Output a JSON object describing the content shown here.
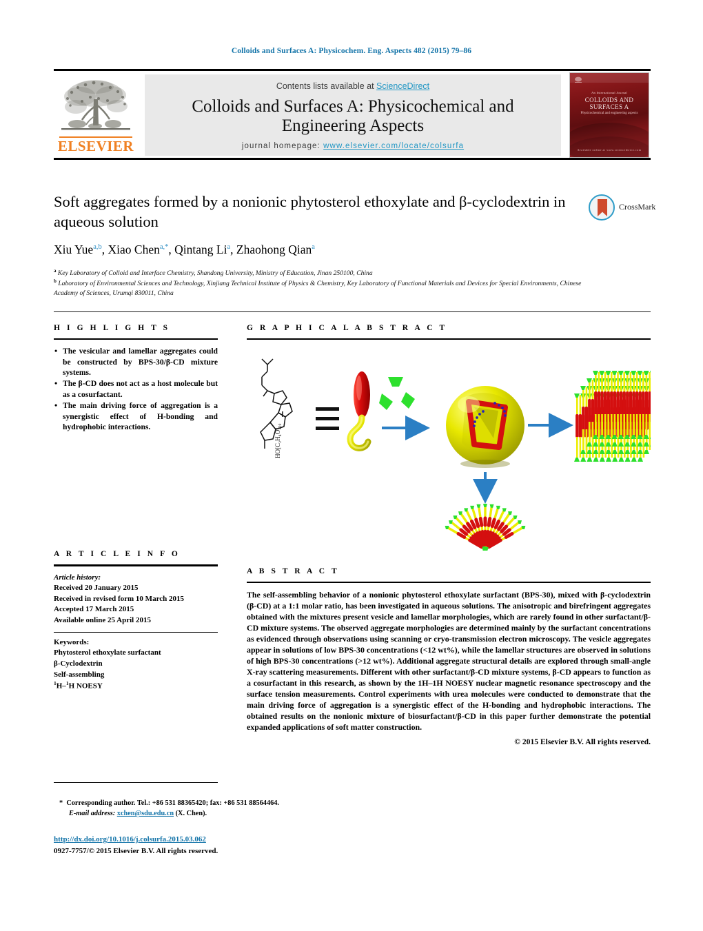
{
  "running_head": "Colloids and Surfaces A: Physicochem. Eng. Aspects 482 (2015) 79–86",
  "masthead": {
    "contents_prefix": "Contents lists available at ",
    "sciencedirect": "ScienceDirect",
    "journal_title_line1": "Colloids and Surfaces A: Physicochemical and",
    "journal_title_line2": "Engineering Aspects",
    "homepage_prefix": "journal homepage:",
    "homepage_url": "www.elsevier.com/locate/colsurfa",
    "publisher": "ELSEVIER",
    "cover": {
      "line_top": "An International Journal",
      "title": "COLLOIDS AND SURFACES A",
      "subtitle": "Physicochemical and engineering aspects",
      "bottom": "Available online at www.sciencedirect.com"
    }
  },
  "article": {
    "title": "Soft aggregates formed by a nonionic phytosterol ethoxylate and β-cyclodextrin in aqueous solution",
    "crossmark_label": "CrossMark",
    "authors": [
      {
        "name": "Xiu Yue",
        "marks": "a,b"
      },
      {
        "name": "Xiao Chen",
        "marks": "a,*"
      },
      {
        "name": "Qintang Li",
        "marks": "a"
      },
      {
        "name": "Zhaohong Qian",
        "marks": "a"
      }
    ],
    "affiliations": [
      {
        "mark": "a",
        "text": "Key Laboratory of Colloid and Interface Chemistry, Shandong University, Ministry of Education, Jinan 250100, China"
      },
      {
        "mark": "b",
        "text": "Laboratory of Environmental Sciences and Technology, Xinjiang Technical Institute of Physics & Chemistry, Key Laboratory of Functional Materials and Devices for Special Environments, Chinese Academy of Sciences, Urumqi 830011, China"
      }
    ]
  },
  "highlights": {
    "heading": "H I G H L I G H T S",
    "items": [
      "The vesicular and lamellar aggregates could be constructed by BPS-30/β-CD mixture systems.",
      "The β-CD does not act as a host molecule but as a cosurfactant.",
      "The main driving force of aggregation is a synergistic effect of H-bonding and hydrophobic interactions."
    ]
  },
  "graphical_abstract": {
    "heading": "G R A P H I C A L   A B S T R A C T",
    "molecule_label": "HO[C2H4O]30",
    "equals_symbol": "=",
    "elements": {
      "surfactant": "BPS-30 surfactant cartoon",
      "cyclodextrin": "β-CD green wedge trimer",
      "vesicle": "cut-away vesicle sphere",
      "lamellar": "lamellar bilayer stack",
      "fan": "curved bilayer fan"
    }
  },
  "article_info": {
    "heading": "A R T I C L E   I N F O",
    "history_label": "Article history:",
    "history": [
      "Received 20 January 2015",
      "Received in revised form 10 March 2015",
      "Accepted 17 March 2015",
      "Available online 25 April 2015"
    ],
    "keywords_label": "Keywords:",
    "keywords": [
      "Phytosterol ethoxylate surfactant",
      "β-Cyclodextrin",
      "Self-assembling",
      "1H–1H NOESY"
    ]
  },
  "abstract": {
    "heading": "A B S T R A C T",
    "text": "The self-assembling behavior of a nonionic phytosterol ethoxylate surfactant (BPS-30), mixed with β-cyclodextrin (β-CD) at a 1:1 molar ratio, has been investigated in aqueous solutions. The anisotropic and birefringent aggregates obtained with the mixtures present vesicle and lamellar morphologies, which are rarely found in other surfactant/β-CD mixture systems. The observed aggregate morphologies are determined mainly by the surfactant concentrations as evidenced through observations using scanning or cryo-transmission electron microscopy. The vesicle aggregates appear in solutions of low BPS-30 concentrations (<12 wt%), while the lamellar structures are observed in solutions of high BPS-30 concentrations (>12 wt%). Additional aggregate structural details are explored through small-angle X-ray scattering measurements. Different with other surfactant/β-CD mixture systems, β-CD appears to function as a cosurfactant in this research, as shown by the 1H–1H NOESY nuclear magnetic resonance spectroscopy and the surface tension measurements. Control experiments with urea molecules were conducted to demonstrate that the main driving force of aggregation is a synergistic effect of the H-bonding and hydrophobic interactions. The obtained results on the nonionic mixture of biosurfactant/β-CD in this paper further demonstrate the potential expanded applications of soft matter construction.",
    "copyright": "© 2015 Elsevier B.V. All rights reserved."
  },
  "footer": {
    "corresponding_marker": "*",
    "corresponding_text": "Corresponding author. Tel.: +86 531 88365420; fax: +86 531 88564464.",
    "email_label": "E-mail address:",
    "email": "xchen@sdu.edu.cn",
    "email_owner": "(X. Chen).",
    "doi": "http://dx.doi.org/10.1016/j.colsurfa.2015.03.062",
    "issn_line": "0927-7757/© 2015 Elsevier B.V. All rights reserved."
  },
  "colors": {
    "link_blue": "#1273a8",
    "sciencedirect_blue": "#2196c4",
    "elsevier_orange": "#f08022",
    "crossmark_blue": "#2e9cc8",
    "surfactant_red": "#d40f0f",
    "surfactant_yellow": "#eded00",
    "cd_green": "#2de02d",
    "arrow_blue": "#2b7fc4"
  }
}
